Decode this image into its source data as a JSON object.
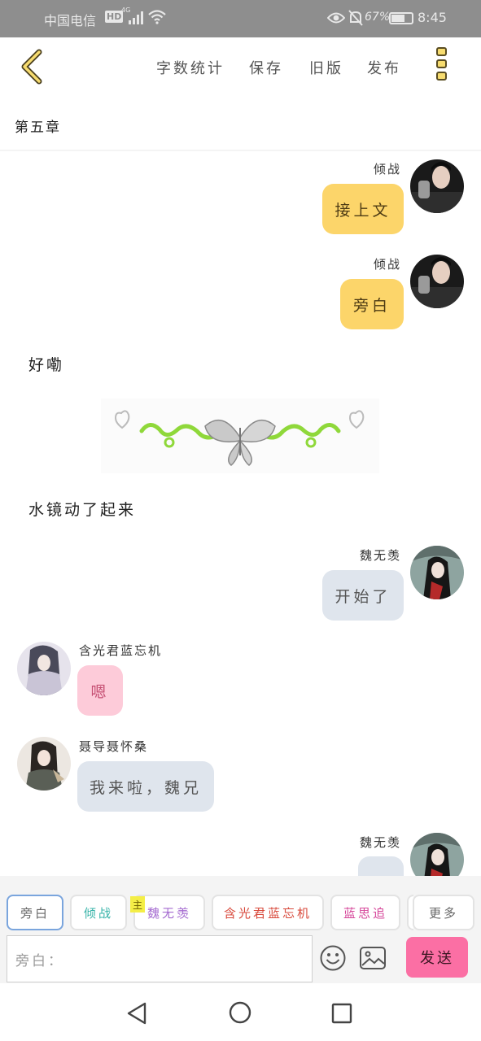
{
  "status_bar": {
    "carrier": "中国电信",
    "hd": "HD",
    "network": "4G",
    "battery_percent": "67%",
    "time": "8:45"
  },
  "toolbar": {
    "word_count": "字数统计",
    "save": "保存",
    "old_version": "旧版",
    "publish": "发布"
  },
  "chapter_title": "第五章",
  "messages": [
    {
      "speaker": "倾战",
      "text": "接上文"
    },
    {
      "speaker": "倾战",
      "text": "旁白"
    },
    {
      "narration": "好嘞"
    },
    {
      "narration": "水镜动了起来"
    },
    {
      "speaker": "魏无羡",
      "text": "开始了"
    },
    {
      "speaker": "含光君蓝忘机",
      "text": "嗯"
    },
    {
      "speaker": "聂导聂怀桑",
      "text": "我来啦，魏兄"
    },
    {
      "speaker": "魏无羡",
      "text": ""
    }
  ],
  "roles": [
    "旁白",
    "倾战",
    "魏无羡",
    "含光君蓝忘机",
    "蓝思追",
    "更多"
  ],
  "main_tag": "主",
  "role_colors": {
    "旁白": "#666666",
    "倾战": "#36b3a8",
    "魏无羡": "#a46ad0",
    "含光君蓝忘机": "#d84a3c",
    "蓝思追": "#d6479a",
    "更多": "#666666"
  },
  "input": {
    "placeholder": "旁白："
  },
  "send_label": "发送",
  "colors": {
    "accent_yellow": "#fcd56a",
    "bubble_grey": "#dfe5ed",
    "bubble_pink": "#fdcbd9",
    "send_pink": "#fb6fa4"
  },
  "icons": {
    "back": "chevron-left-icon",
    "menu": "more-vertical-icon",
    "emoji": "smiley-icon",
    "image": "image-icon"
  }
}
